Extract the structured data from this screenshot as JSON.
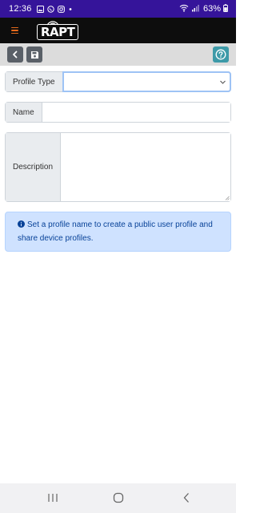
{
  "status_bar": {
    "time": "12:36",
    "battery": "63%",
    "icons": [
      "gallery-icon",
      "whatsapp-icon",
      "instagram-icon",
      "dot-icon",
      "wifi-icon",
      "signal-icon",
      "battery-icon"
    ]
  },
  "app_bar": {
    "logo_text": "RAPT",
    "menu_icon": "hamburger-icon",
    "accent_color": "#e66a1c"
  },
  "toolbar": {
    "icons": [
      "chevron-left-icon",
      "save-icon",
      "help-icon"
    ],
    "help_color": "#3d9aa8"
  },
  "form": {
    "profile_type_label": "Profile Type",
    "profile_type_value": "",
    "name_label": "Name",
    "name_value": "",
    "description_label": "Description",
    "description_value": ""
  },
  "alert": {
    "text": "Set a profile name to create a public user profile and share device profiles.",
    "icon": "info-circle-icon"
  },
  "nav_bar": {
    "icons": [
      "recents-icon",
      "home-icon",
      "back-icon"
    ]
  }
}
